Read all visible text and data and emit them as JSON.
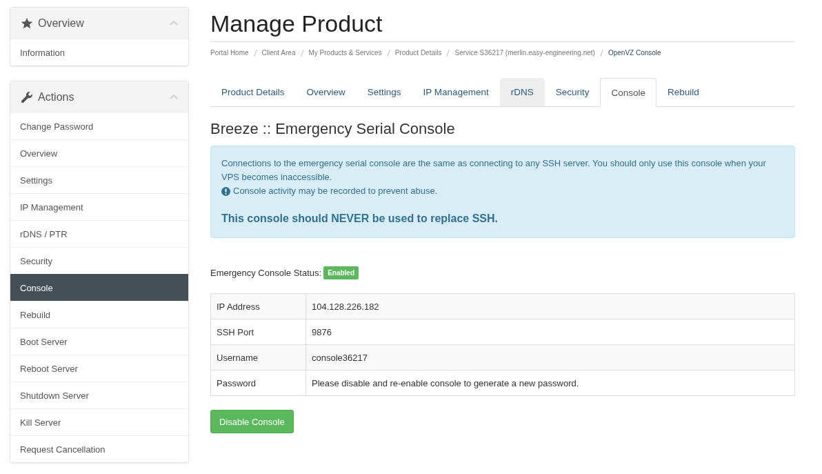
{
  "sidebar": {
    "panels": [
      {
        "title": "Overview",
        "expanded": true,
        "items": [
          {
            "label": "Information",
            "selected": false
          }
        ]
      },
      {
        "title": "Actions",
        "expanded": true,
        "items": [
          {
            "label": "Change Password",
            "selected": false
          },
          {
            "label": "Overview",
            "selected": false
          },
          {
            "label": "Settings",
            "selected": false
          },
          {
            "label": "IP Management",
            "selected": false
          },
          {
            "label": "rDNS / PTR",
            "selected": false
          },
          {
            "label": "Security",
            "selected": false
          },
          {
            "label": "Console",
            "selected": true
          },
          {
            "label": "Rebuild",
            "selected": false
          },
          {
            "label": "Boot Server",
            "selected": false
          },
          {
            "label": "Reboot Server",
            "selected": false
          },
          {
            "label": "Shutdown Server",
            "selected": false
          },
          {
            "label": "Kill Server",
            "selected": false
          },
          {
            "label": "Request Cancellation",
            "selected": false
          }
        ]
      }
    ]
  },
  "page": {
    "title": "Manage Product",
    "breadcrumb": [
      {
        "label": "Portal Home",
        "current": false
      },
      {
        "label": "Client Area",
        "current": false
      },
      {
        "label": "My Products & Services",
        "current": false
      },
      {
        "label": "Product Details",
        "current": false
      },
      {
        "label": "Service S36217 (merlin.easy-engineering.net)",
        "current": false
      },
      {
        "label": "OpenVZ Console",
        "current": true
      }
    ]
  },
  "tabs": [
    {
      "label": "Product Details",
      "selected": false,
      "hovered": false
    },
    {
      "label": "Overview",
      "selected": false,
      "hovered": false
    },
    {
      "label": "Settings",
      "selected": false,
      "hovered": false
    },
    {
      "label": "IP Management",
      "selected": false,
      "hovered": false
    },
    {
      "label": "rDNS",
      "selected": false,
      "hovered": true
    },
    {
      "label": "Security",
      "selected": false,
      "hovered": false
    },
    {
      "label": "Console",
      "selected": true,
      "hovered": false
    },
    {
      "label": "Rebuild",
      "selected": false,
      "hovered": false
    }
  ],
  "section_title": "Breeze :: Emergency Serial Console",
  "alert": {
    "message": "Connections to the emergency serial console are the same as connecting to any SSH server. You should only use this console when your VPS becomes inaccessible.",
    "note": "Console activity may be recorded to prevent abuse.",
    "warning": "This console should NEVER be used to replace SSH."
  },
  "status": {
    "label": "Emergency Console Status:",
    "badge": "Enabled",
    "enabled": true
  },
  "details_table": {
    "rows": [
      {
        "label": "IP Address",
        "value": "104.128.226.182"
      },
      {
        "label": "SSH Port",
        "value": "9876"
      },
      {
        "label": "Username",
        "value": "console36217"
      },
      {
        "label": "Password",
        "value": "Please disable and re-enable console to generate a new password."
      }
    ]
  },
  "buttons": [
    {
      "label": "Disable Console"
    }
  ]
}
